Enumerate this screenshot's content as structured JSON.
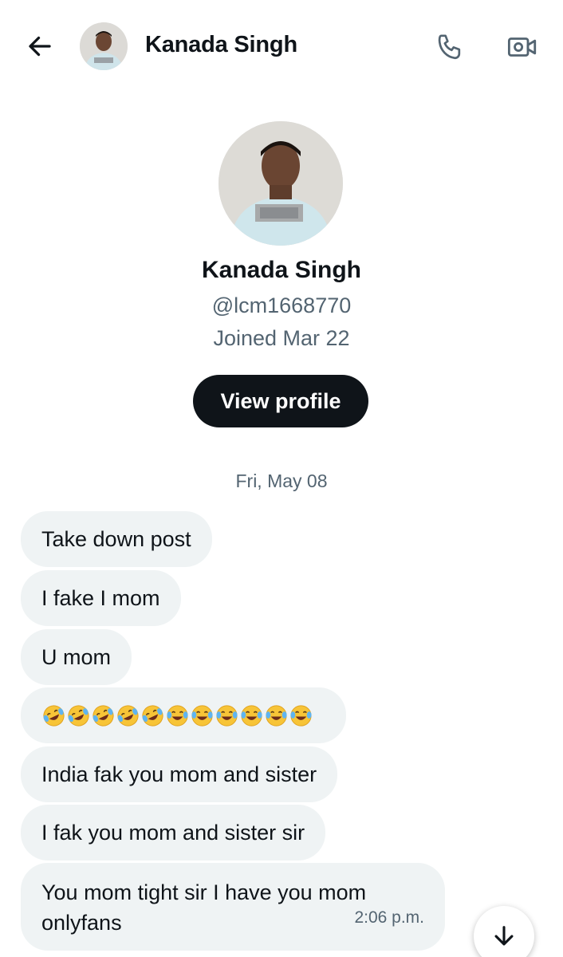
{
  "header": {
    "name": "Kanada Singh",
    "back_icon": "arrow-left-icon",
    "call_icon": "phone-icon",
    "video_icon": "video-camera-icon"
  },
  "profile": {
    "name": "Kanada Singh",
    "handle": "@lcm1668770",
    "joined": "Joined Mar 22",
    "view_profile_label": "View profile"
  },
  "date_separator": "Fri, May 08",
  "messages": [
    {
      "text": "Take down post"
    },
    {
      "text": "I fake I mom"
    },
    {
      "text": "U mom"
    },
    {
      "text": "🤣🤣🤣🤣🤣😂😂😂😂😂😂"
    },
    {
      "text": "India fak you mom and sister"
    },
    {
      "text": "I fak you mom and sister sir"
    },
    {
      "text": "You mom tight sir I have you mom onlyfans",
      "time": "2:06 p.m."
    }
  ],
  "scroll_icon": "arrow-down-icon",
  "colors": {
    "text_primary": "#0f1419",
    "text_secondary": "#536471",
    "bubble_bg": "#eff3f4",
    "button_bg": "#0f1419"
  }
}
